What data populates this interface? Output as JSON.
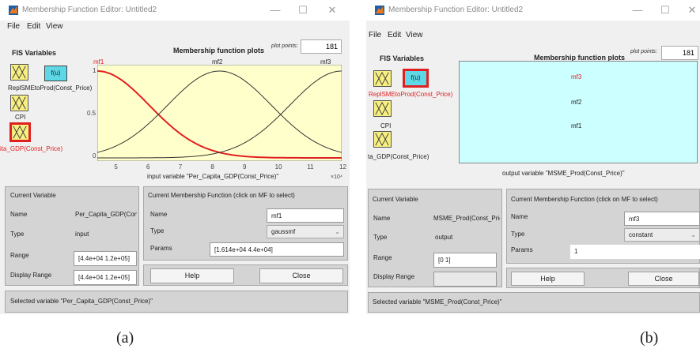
{
  "window_a": {
    "title": "Membership Function Editor: Untitled2",
    "controls": {
      "minimize": "—",
      "maximize": "☐",
      "close": "✕"
    },
    "menu": [
      "File",
      "Edit",
      "View"
    ],
    "fis_variables_title": "FIS Variables",
    "system_box_label": "f(u)",
    "variable_labels": {
      "output_overlap": "ReplSMEtoProd(Const_Price)",
      "input2": "CPI",
      "input3": "ita_GDP(Const_Price)"
    },
    "plot_title": "Membership function plots",
    "plot_points_label": "plot points:",
    "plot_points_value": "181",
    "mf_labels": [
      "mf1",
      "mf2",
      "mf3"
    ],
    "y_ticks": [
      "1",
      "0.5",
      "0"
    ],
    "x_ticks": [
      "5",
      "6",
      "7",
      "8",
      "9",
      "10",
      "11",
      "12"
    ],
    "x_axis_label": "input variable \"Per_Capita_GDP(Const_Price)\"",
    "x_exponent": "×10⁴",
    "current_variable": {
      "title": "Current Variable",
      "name_label": "Name",
      "name_value": "Per_Capita_GDP(Const_Price)",
      "type_label": "Type",
      "type_value": "input",
      "range_label": "Range",
      "range_value": "[4.4e+04 1.2e+05]",
      "display_range_label": "Display Range",
      "display_range_value": "[4.4e+04 1.2e+05]"
    },
    "current_mf": {
      "title": "Current Membership Function (click on MF to select)",
      "name_label": "Name",
      "name_value": "mf1",
      "type_label": "Type",
      "type_value": "gaussmf",
      "params_label": "Params",
      "params_value": "[1.614e+04 4.4e+04]"
    },
    "help_button": "Help",
    "close_button": "Close",
    "status": "Selected variable \"Per_Capita_GDP(Const_Price)\""
  },
  "window_b": {
    "title": "Membership Function Editor: Untitled2",
    "controls": {
      "minimize": "—",
      "maximize": "☐",
      "close": "✕"
    },
    "menu": [
      "File",
      "Edit",
      "View"
    ],
    "fis_variables_title": "FIS Variables",
    "system_box_label": "f(u)",
    "variable_labels": {
      "output_overlap": "ReplSMEtoProd(Const_Price)",
      "input2": "CPI",
      "input3": "ta_GDP(Const_Price)"
    },
    "plot_title": "Membership function plots",
    "plot_points_label": "plot points:",
    "plot_points_value": "181",
    "mf_labels": [
      "mf3",
      "mf2",
      "mf1"
    ],
    "x_axis_label": "output variable \"MSME_Prod(Const_Price)\"",
    "current_variable": {
      "title": "Current Variable",
      "name_label": "Name",
      "name_value": "MSME_Prod(Const_Price)",
      "type_label": "Type",
      "type_value": "output",
      "range_label": "Range",
      "range_value": "[0 1]",
      "display_range_label": "Display Range",
      "display_range_value": ""
    },
    "current_mf": {
      "title": "Current Membership Function (click on MF to select)",
      "name_label": "Name",
      "name_value": "mf3",
      "type_label": "Type",
      "type_value": "constant",
      "params_label": "Params",
      "params_value": "1"
    },
    "help_button": "Help",
    "close_button": "Close",
    "status": "Selected variable \"MSME_Prod(Const_Price)\""
  },
  "captions": [
    "(a)",
    "(b)"
  ],
  "colors": {
    "selected_border": "#e02020",
    "plot_bg_input": "#ffffcc",
    "plot_bg_output": "#ccffff",
    "system_box": "#5ed8e6",
    "var_icon": "#f7ef82"
  }
}
